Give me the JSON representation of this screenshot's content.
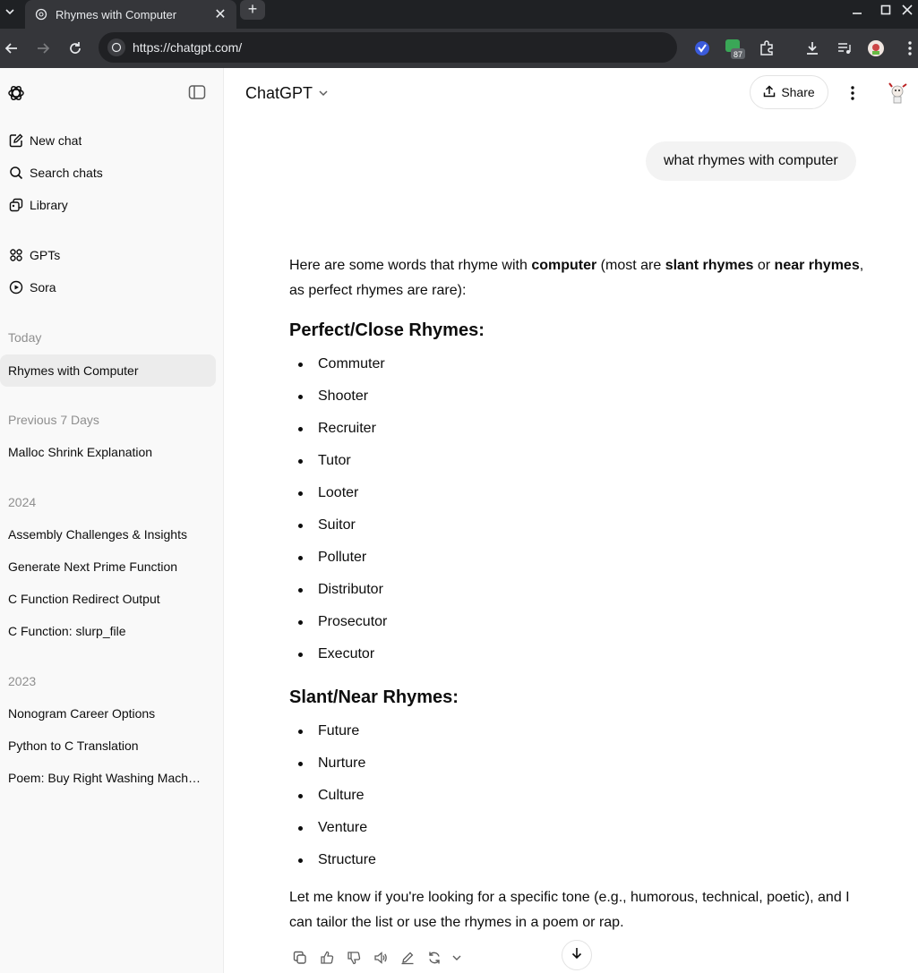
{
  "browser": {
    "tab_title": "Rhymes with Computer",
    "new_tab_symbol": "+",
    "url": "https://chatgpt.com/",
    "extension_badge": "87"
  },
  "sidebar": {
    "actions": [
      {
        "label": "New chat",
        "icon": "edit-icon"
      },
      {
        "label": "Search chats",
        "icon": "search-icon"
      },
      {
        "label": "Library",
        "icon": "library-icon"
      }
    ],
    "apps": [
      {
        "label": "GPTs",
        "icon": "grid-icon"
      },
      {
        "label": "Sora",
        "icon": "play-icon"
      }
    ],
    "sections": [
      {
        "title": "Today",
        "items": [
          "Rhymes with Computer"
        ]
      },
      {
        "title": "Previous 7 Days",
        "items": [
          "Malloc Shrink Explanation"
        ]
      },
      {
        "title": "2024",
        "items": [
          "Assembly Challenges & Insights",
          "Generate Next Prime Function",
          "C Function Redirect Output",
          "C Function: slurp_file"
        ]
      },
      {
        "title": "2023",
        "items": [
          "Nonogram Career Options",
          "Python to C Translation",
          "Poem: Buy Right Washing Mach…"
        ]
      }
    ]
  },
  "header": {
    "model": "ChatGPT",
    "share_label": "Share"
  },
  "conversation": {
    "user_message": "what rhymes with computer",
    "intro": {
      "t1": "Here are some words that rhyme with ",
      "b1": "computer",
      "t2": " (most are ",
      "b2": "slant rhymes",
      "t3": " or ",
      "b3": "near rhymes",
      "t4": ", as perfect rhymes are rare):"
    },
    "heading1": "Perfect/Close Rhymes:",
    "list1": [
      "Commuter",
      "Shooter",
      "Recruiter",
      "Tutor",
      "Looter",
      "Suitor",
      "Polluter",
      "Distributor",
      "Prosecutor",
      "Executor"
    ],
    "heading2": "Slant/Near Rhymes:",
    "list2": [
      "Future",
      "Nurture",
      "Culture",
      "Venture",
      "Structure"
    ],
    "closing": "Let me know if you're looking for a specific tone (e.g., humorous, technical, poetic), and I can tailor the list or use the rhymes in a poem or rap."
  }
}
